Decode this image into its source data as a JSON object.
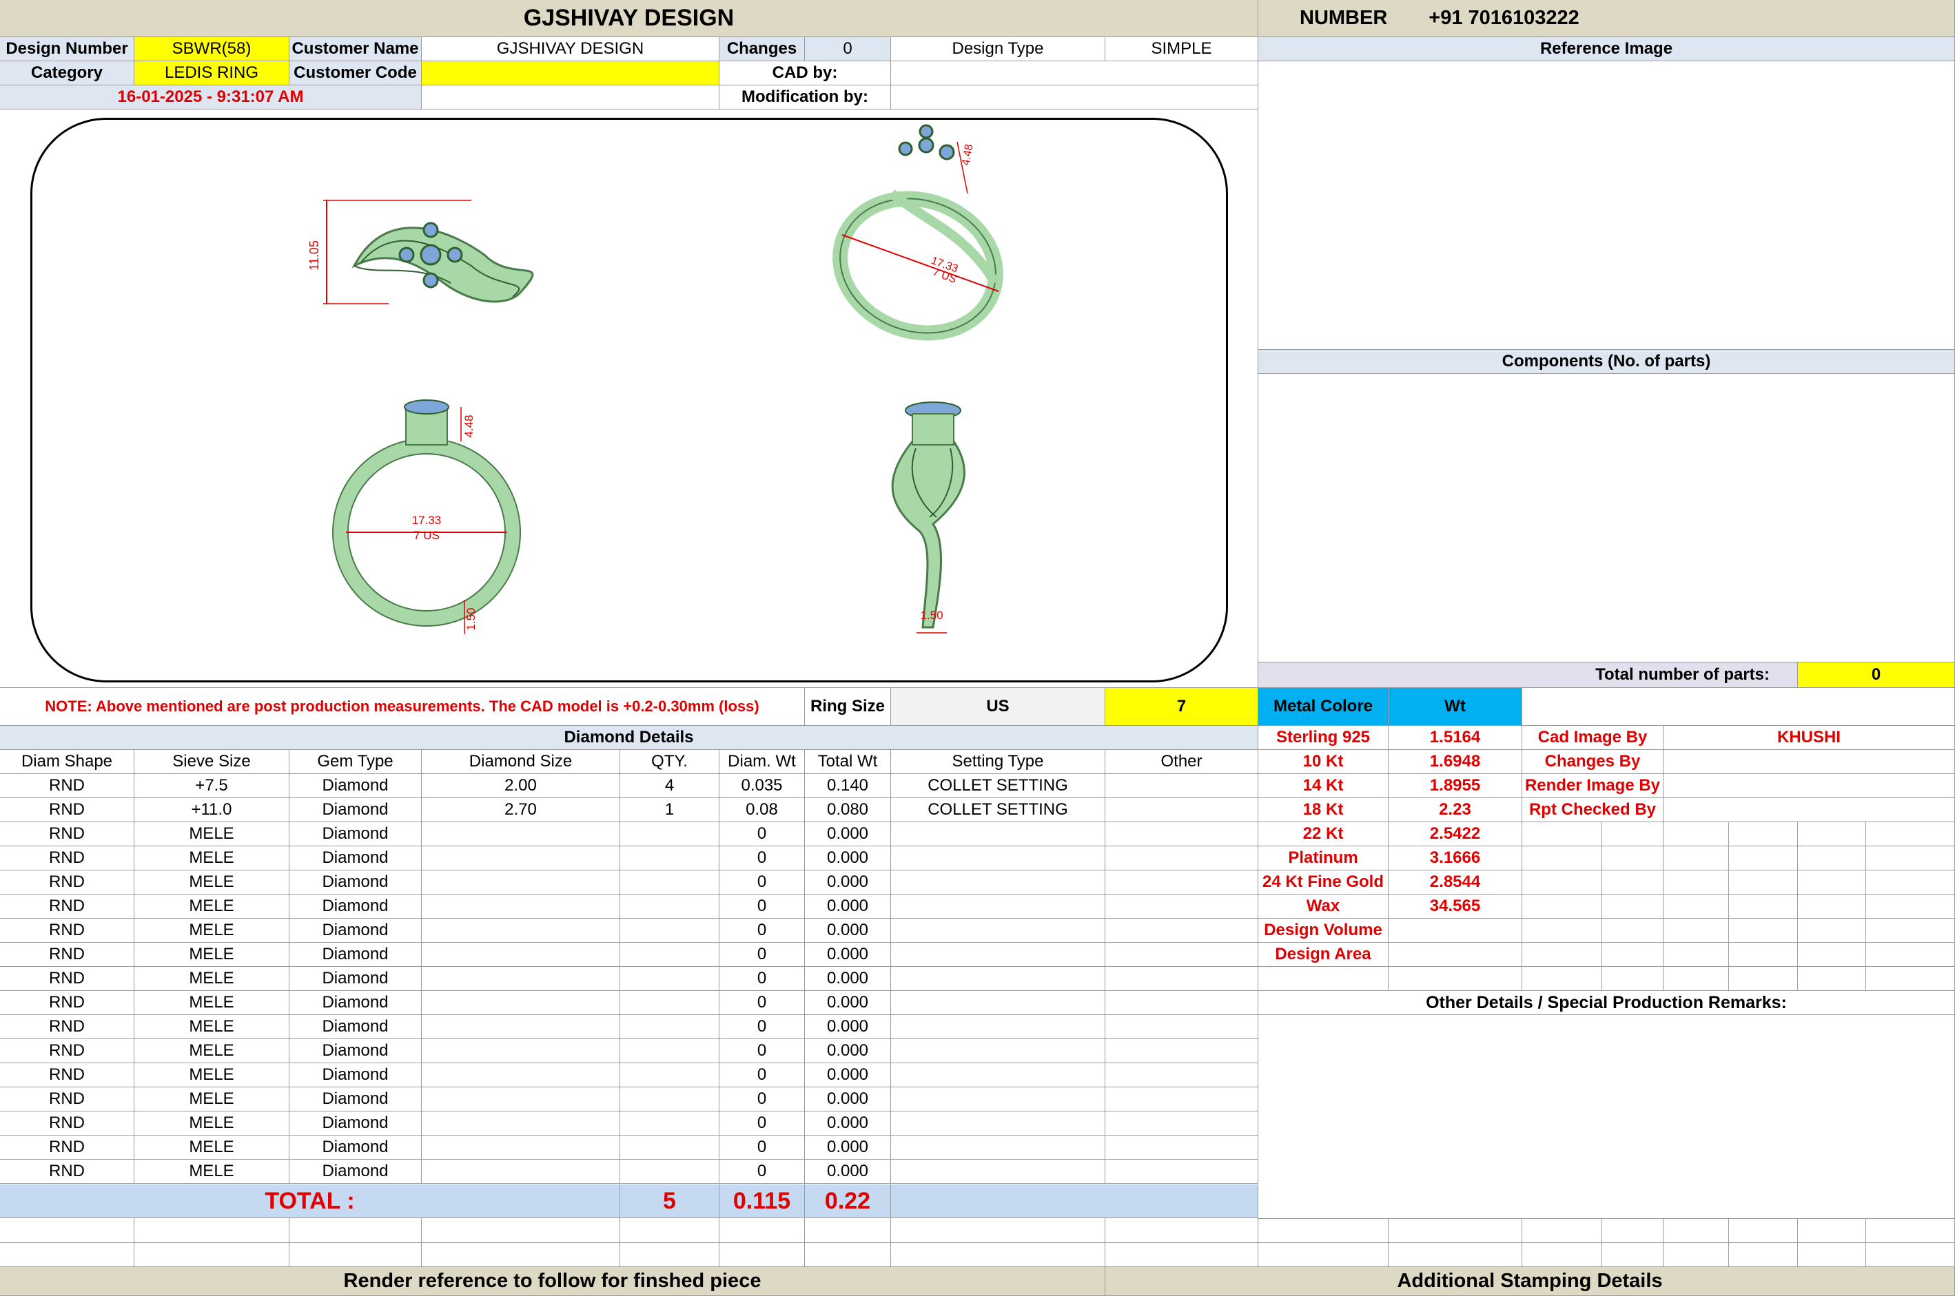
{
  "header": {
    "company": "GJSHIVAY DESIGN",
    "number_label": "NUMBER",
    "number_value": "+91 7016103222"
  },
  "info": {
    "design_number_label": "Design Number",
    "design_number": "SBWR(58)",
    "customer_name_label": "Customer Name",
    "customer_name": "GJSHIVAY DESIGN",
    "changes_label": "Changes",
    "changes": "0",
    "design_type_label": "Design Type",
    "design_type": "SIMPLE",
    "category_label": "Category",
    "category": "LEDIS RING",
    "customer_code_label": "Customer Code",
    "customer_code": "",
    "cad_by_label": "CAD by:",
    "cad_by": "",
    "date": "16-01-2025 - 9:31:07 AM",
    "modification_by_label": "Modification by:",
    "modification_by": ""
  },
  "ring_views": {
    "top_height": "11.05",
    "setting_height": "4.48",
    "inner_diameter": "17.33",
    "ring_size_us": "7 US",
    "band_width": "1.50"
  },
  "right_panel": {
    "reference_image": "Reference Image",
    "components": "Components (No. of parts)",
    "total_parts_label": "Total number of parts:",
    "total_parts": "0",
    "other_details": "Other Details / Special Production Remarks:"
  },
  "note": "NOTE: Above mentioned are post production measurements. The CAD model is +0.2-0.30mm (loss)",
  "ring_size": {
    "label": "Ring Size",
    "system": "US",
    "value": "7"
  },
  "metal": {
    "header_color": "Metal Colore",
    "header_wt": "Wt",
    "rows": [
      {
        "name": "Sterling 925",
        "wt": "1.5164"
      },
      {
        "name": "10 Kt",
        "wt": "1.6948"
      },
      {
        "name": "14 Kt",
        "wt": "1.8955"
      },
      {
        "name": "18 Kt",
        "wt": "2.23"
      },
      {
        "name": "22 Kt",
        "wt": "2.5422"
      },
      {
        "name": "Platinum",
        "wt": "3.1666"
      },
      {
        "name": "24 Kt Fine Gold",
        "wt": "2.8544"
      },
      {
        "name": "Wax",
        "wt": "34.565"
      },
      {
        "name": "Design Volume",
        "wt": ""
      },
      {
        "name": "Design Area",
        "wt": ""
      }
    ]
  },
  "credits": [
    {
      "label": "Cad Image By",
      "value": "KHUSHI"
    },
    {
      "label": "Changes By",
      "value": ""
    },
    {
      "label": "Render Image By",
      "value": ""
    },
    {
      "label": "Rpt Checked By",
      "value": ""
    }
  ],
  "diamond": {
    "title": "Diamond Details",
    "headers": [
      "Diam Shape",
      "Sieve Size",
      "Gem Type",
      "Diamond Size",
      "QTY.",
      "Diam. Wt",
      "Total Wt",
      "Setting Type",
      "Other"
    ],
    "rows": [
      [
        "RND",
        "+7.5",
        "Diamond",
        "2.00",
        "4",
        "0.035",
        "0.140",
        "COLLET SETTING",
        ""
      ],
      [
        "RND",
        "+11.0",
        "Diamond",
        "2.70",
        "1",
        "0.08",
        "0.080",
        "COLLET SETTING",
        ""
      ],
      [
        "RND",
        "MELE",
        "Diamond",
        "",
        "",
        "0",
        "0.000",
        "",
        ""
      ],
      [
        "RND",
        "MELE",
        "Diamond",
        "",
        "",
        "0",
        "0.000",
        "",
        ""
      ],
      [
        "RND",
        "MELE",
        "Diamond",
        "",
        "",
        "0",
        "0.000",
        "",
        ""
      ],
      [
        "RND",
        "MELE",
        "Diamond",
        "",
        "",
        "0",
        "0.000",
        "",
        ""
      ],
      [
        "RND",
        "MELE",
        "Diamond",
        "",
        "",
        "0",
        "0.000",
        "",
        ""
      ],
      [
        "RND",
        "MELE",
        "Diamond",
        "",
        "",
        "0",
        "0.000",
        "",
        ""
      ],
      [
        "RND",
        "MELE",
        "Diamond",
        "",
        "",
        "0",
        "0.000",
        "",
        ""
      ],
      [
        "RND",
        "MELE",
        "Diamond",
        "",
        "",
        "0",
        "0.000",
        "",
        ""
      ],
      [
        "RND",
        "MELE",
        "Diamond",
        "",
        "",
        "0",
        "0.000",
        "",
        ""
      ],
      [
        "RND",
        "MELE",
        "Diamond",
        "",
        "",
        "0",
        "0.000",
        "",
        ""
      ],
      [
        "RND",
        "MELE",
        "Diamond",
        "",
        "",
        "0",
        "0.000",
        "",
        ""
      ],
      [
        "RND",
        "MELE",
        "Diamond",
        "",
        "",
        "0",
        "0.000",
        "",
        ""
      ],
      [
        "RND",
        "MELE",
        "Diamond",
        "",
        "",
        "0",
        "0.000",
        "",
        ""
      ],
      [
        "RND",
        "MELE",
        "Diamond",
        "",
        "",
        "0",
        "0.000",
        "",
        ""
      ],
      [
        "RND",
        "MELE",
        "Diamond",
        "",
        "",
        "0",
        "0.000",
        "",
        ""
      ]
    ],
    "total_label": "TOTAL :",
    "total_qty": "5",
    "total_diam_wt": "0.115",
    "total_wt": "0.22"
  },
  "footer": {
    "left": "Render reference to follow for finshed piece",
    "right": "Additional Stamping Details"
  }
}
